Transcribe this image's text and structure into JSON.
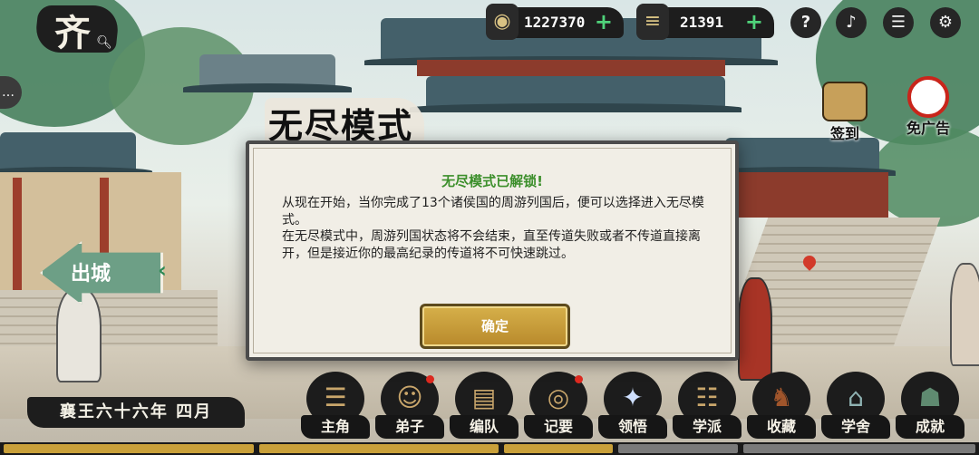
{
  "header": {
    "region_char": "齐",
    "resources": [
      {
        "icon": "copper-coin-icon",
        "value": "1227370"
      },
      {
        "icon": "bamboo-scroll-icon",
        "value": "21391"
      }
    ],
    "help_label": "?"
  },
  "side_actions": [
    {
      "label": "签到",
      "icon": "sign-in-scroll-icon"
    },
    {
      "label": "免广告",
      "icon": "no-ads-camera-icon"
    }
  ],
  "exit_button": {
    "label": "出城"
  },
  "date_label": "襄王六十六年 四月",
  "dialog": {
    "title": "无尽模式",
    "heading": "无尽模式已解锁!",
    "paragraphs": [
      "从现在开始，当你完成了13个诸侯国的周游列国后，便可以选择进入无尽模式。",
      "在无尽模式中，周游列国状态将不会结束，直至传道失败或者不传道直接离开，但是接近你的最高纪录的传道将不可快速跳过。"
    ],
    "confirm_label": "确定"
  },
  "bottom_menu": [
    {
      "label": "主角",
      "icon": "scroll-icon",
      "badge": false
    },
    {
      "label": "弟子",
      "icon": "disciple-portrait-icon",
      "badge": true
    },
    {
      "label": "编队",
      "icon": "book-icon",
      "badge": false
    },
    {
      "label": "记要",
      "icon": "brush-inkstone-icon",
      "badge": true
    },
    {
      "label": "领悟",
      "icon": "lightning-insight-icon",
      "badge": false
    },
    {
      "label": "学派",
      "icon": "scroll-bundle-icon",
      "badge": false
    },
    {
      "label": "收藏",
      "icon": "horse-statue-icon",
      "badge": false
    },
    {
      "label": "学舍",
      "icon": "school-building-icon",
      "badge": false
    },
    {
      "label": "成就",
      "icon": "bronze-ding-icon",
      "badge": false
    }
  ],
  "colors": {
    "accent_green": "#3c8f2b",
    "plus_green": "#4fd27a",
    "confirm_gold": "#c9a03a",
    "badge_red": "#e02a20"
  }
}
